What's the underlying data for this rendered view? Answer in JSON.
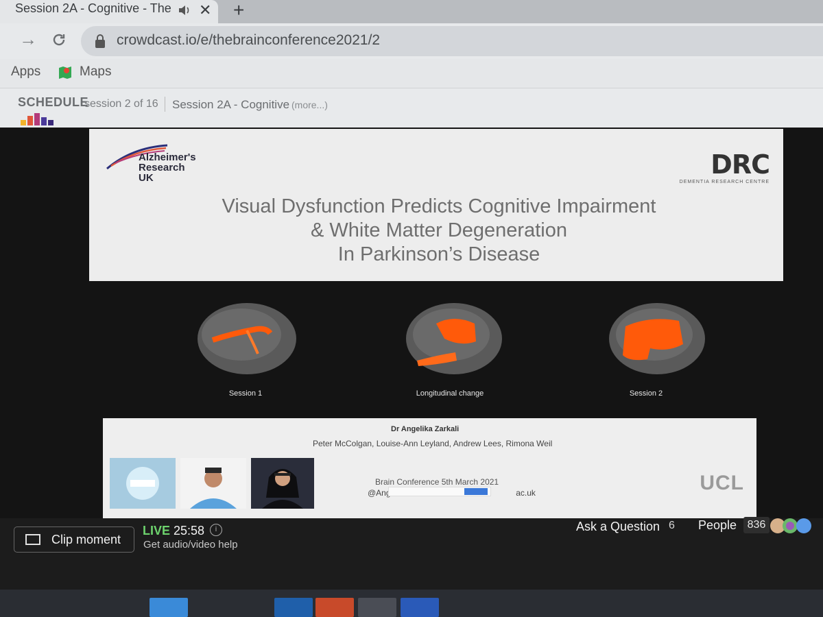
{
  "browser": {
    "tab_title": "Session 2A - Cognitive - The",
    "new_tab_symbol": "+",
    "close_symbol": "✕",
    "url": "crowdcast.io/e/thebrainconference2021/2",
    "bookmarks": [
      "Apps",
      "Maps"
    ]
  },
  "schedule": {
    "label": "SCHEDULE",
    "progress": "session 2 of 16",
    "session_title": "Session 2A - Cognitive",
    "more": "(more...)"
  },
  "slide": {
    "org_logo_text": "Alzheimer's Research UK",
    "org_line1": "Alzheimer's",
    "org_line2": "Research",
    "org_line3": "UK",
    "drc": "DRC",
    "drc_subtitle": "DEMENTIA RESEARCH CENTRE",
    "title_line1": "Visual Dysfunction Predicts Cognitive Impairment",
    "title_line2": "& White Matter Degeneration",
    "title_line3": "In Parkinson’s Disease",
    "brain_labels": [
      "Session 1",
      "Longitudinal change",
      "Session 2"
    ],
    "presenter": "Dr Angelika Zarkali",
    "authors": "Peter McColgan, Louise-Ann Leyland, Andrew Lees, Rimona Weil",
    "conference": "Brain Conference 5th March 2021",
    "email_fragment_start": "@Ang",
    "email_fragment_end": "ac.uk",
    "ucl_logo": "UCL"
  },
  "bottom": {
    "clip_label": "Clip moment",
    "live_label": "LIVE",
    "timer": "25:58",
    "info_symbol": "i",
    "av_help": "Get audio/video help",
    "ask_label": "Ask a Question",
    "ask_count": "6",
    "people_label": "People",
    "people_count": "836"
  },
  "colors": {
    "live_green": "#6dd36d",
    "brain_highlight": "#ff5a0a",
    "stage_bg": "#141414"
  }
}
